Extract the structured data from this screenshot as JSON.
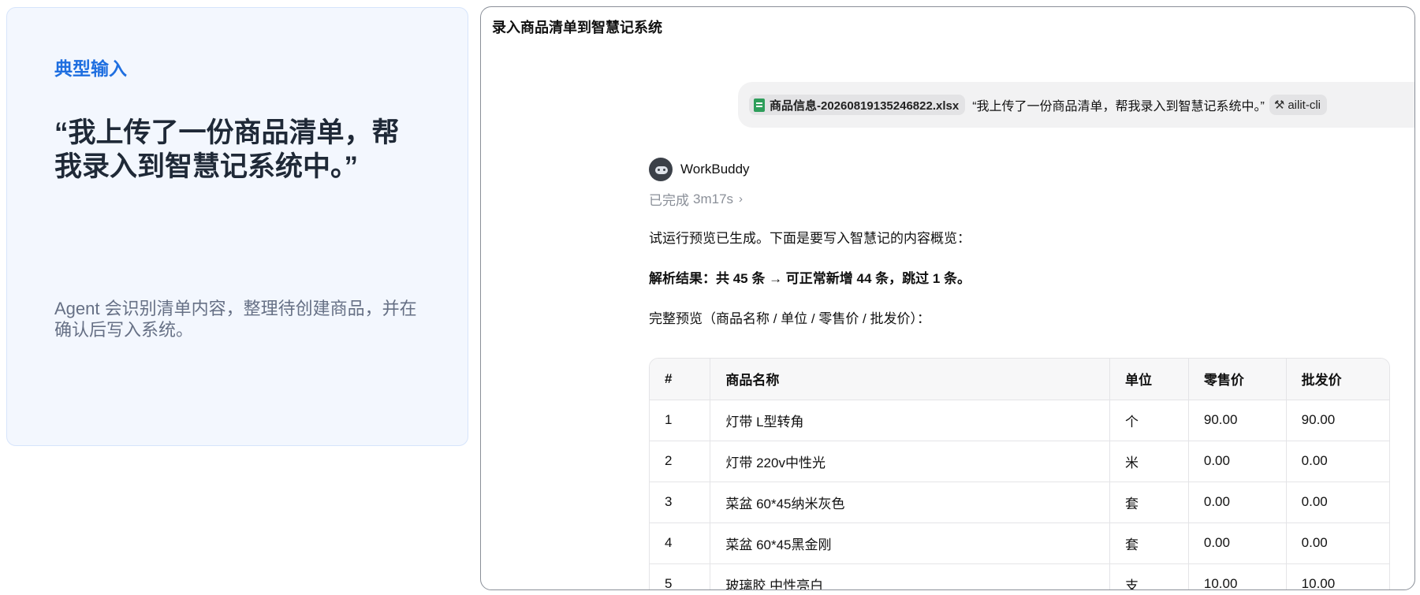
{
  "info": {
    "tag": "典型输入",
    "quote": "“我上传了一份商品清单，帮我录入到智慧记系统中。”",
    "desc": "Agent 会识别清单内容，整理待创建商品，并在确认后写入系统。"
  },
  "chat": {
    "title": "录入商品清单到智慧记系统",
    "user_message": {
      "file_name": "商品信息-20260819135246822.xlsx",
      "text": "“我上传了一份商品清单，帮我录入到智慧记系统中。”",
      "skill": "ailit-cli"
    },
    "assistant": {
      "name": "WorkBuddy",
      "status": "已完成",
      "duration": "3m17s",
      "line1": "试运行预览已生成。下面是要写入智慧记的内容概览：",
      "line2": "解析结果：共 45 条 → 可正常新增 44 条，跳过 1 条。",
      "line3": "完整预览（商品名称 / 单位 / 零售价 / 批发价）：",
      "table": {
        "headers": [
          "#",
          "商品名称",
          "单位",
          "零售价",
          "批发价"
        ],
        "rows": [
          [
            "1",
            "灯带 L型转角",
            "个",
            "90.00",
            "90.00"
          ],
          [
            "2",
            "灯带 220v中性光",
            "米",
            "0.00",
            "0.00"
          ],
          [
            "3",
            "菜盆 60*45纳米灰色",
            "套",
            "0.00",
            "0.00"
          ],
          [
            "4",
            "菜盆 60*45黑金刚",
            "套",
            "0.00",
            "0.00"
          ],
          [
            "5",
            "玻璃胶 中性亮白",
            "支",
            "10.00",
            "10.00"
          ]
        ]
      }
    }
  }
}
